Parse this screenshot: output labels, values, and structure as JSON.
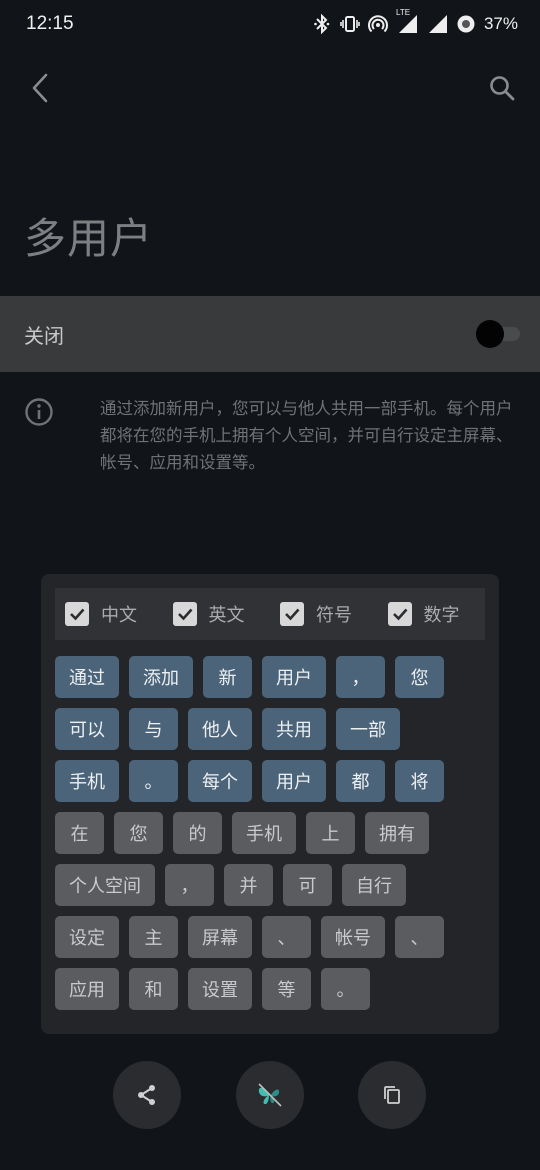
{
  "status_bar": {
    "time": "12:15",
    "network_label": "LTE",
    "battery": "37%",
    "icons": [
      "bluetooth-icon",
      "vibrate-icon",
      "hotspot-icon",
      "signal-icon",
      "wifi-signal-icon",
      "battery-saver-icon"
    ]
  },
  "app_bar": {
    "back_icon": "chevron-left-icon",
    "search_icon": "search-icon"
  },
  "page": {
    "title": "多用户",
    "toggle_label": "关闭",
    "toggle_on": false,
    "info_text": "通过添加新用户，您可以与他人共用一部手机。每个用户都将在您的手机上拥有个人空间，并可自行设定主屏幕、帐号、应用和设置等。"
  },
  "word_panel": {
    "filters": [
      {
        "label": "中文",
        "checked": true
      },
      {
        "label": "英文",
        "checked": true
      },
      {
        "label": "符号",
        "checked": true
      },
      {
        "label": "数字",
        "checked": true
      }
    ],
    "rows": [
      [
        {
          "text": "通过",
          "selected": true
        },
        {
          "text": "添加",
          "selected": true
        },
        {
          "text": "新",
          "selected": true
        },
        {
          "text": "用户",
          "selected": true
        },
        {
          "text": "，",
          "selected": true
        },
        {
          "text": "您",
          "selected": true
        }
      ],
      [
        {
          "text": "可以",
          "selected": true
        },
        {
          "text": "与",
          "selected": true
        },
        {
          "text": "他人",
          "selected": true
        },
        {
          "text": "共用",
          "selected": true
        },
        {
          "text": "一部",
          "selected": true
        }
      ],
      [
        {
          "text": "手机",
          "selected": true
        },
        {
          "text": "。",
          "selected": true
        },
        {
          "text": "每个",
          "selected": true
        },
        {
          "text": "用户",
          "selected": true
        },
        {
          "text": "都",
          "selected": true
        },
        {
          "text": "将",
          "selected": true
        }
      ],
      [
        {
          "text": "在",
          "selected": false
        },
        {
          "text": "您",
          "selected": false
        },
        {
          "text": "的",
          "selected": false
        },
        {
          "text": "手机",
          "selected": false
        },
        {
          "text": "上",
          "selected": false
        },
        {
          "text": "拥有",
          "selected": false
        }
      ],
      [
        {
          "text": "个人空间",
          "selected": false
        },
        {
          "text": "，",
          "selected": false
        },
        {
          "text": "并",
          "selected": false
        },
        {
          "text": "可",
          "selected": false
        },
        {
          "text": "自行",
          "selected": false
        }
      ],
      [
        {
          "text": "设定",
          "selected": false
        },
        {
          "text": "主",
          "selected": false
        },
        {
          "text": "屏幕",
          "selected": false
        },
        {
          "text": "、",
          "selected": false
        },
        {
          "text": "帐号",
          "selected": false
        },
        {
          "text": "、",
          "selected": false
        }
      ],
      [
        {
          "text": "应用",
          "selected": false
        },
        {
          "text": "和",
          "selected": false
        },
        {
          "text": "设置",
          "selected": false
        },
        {
          "text": "等",
          "selected": false
        },
        {
          "text": "。",
          "selected": false
        }
      ]
    ]
  },
  "bottom_actions": {
    "icons": [
      "share-icon",
      "butterfly-search-icon",
      "copy-icon"
    ],
    "accent_color": "#3fbfb2"
  }
}
